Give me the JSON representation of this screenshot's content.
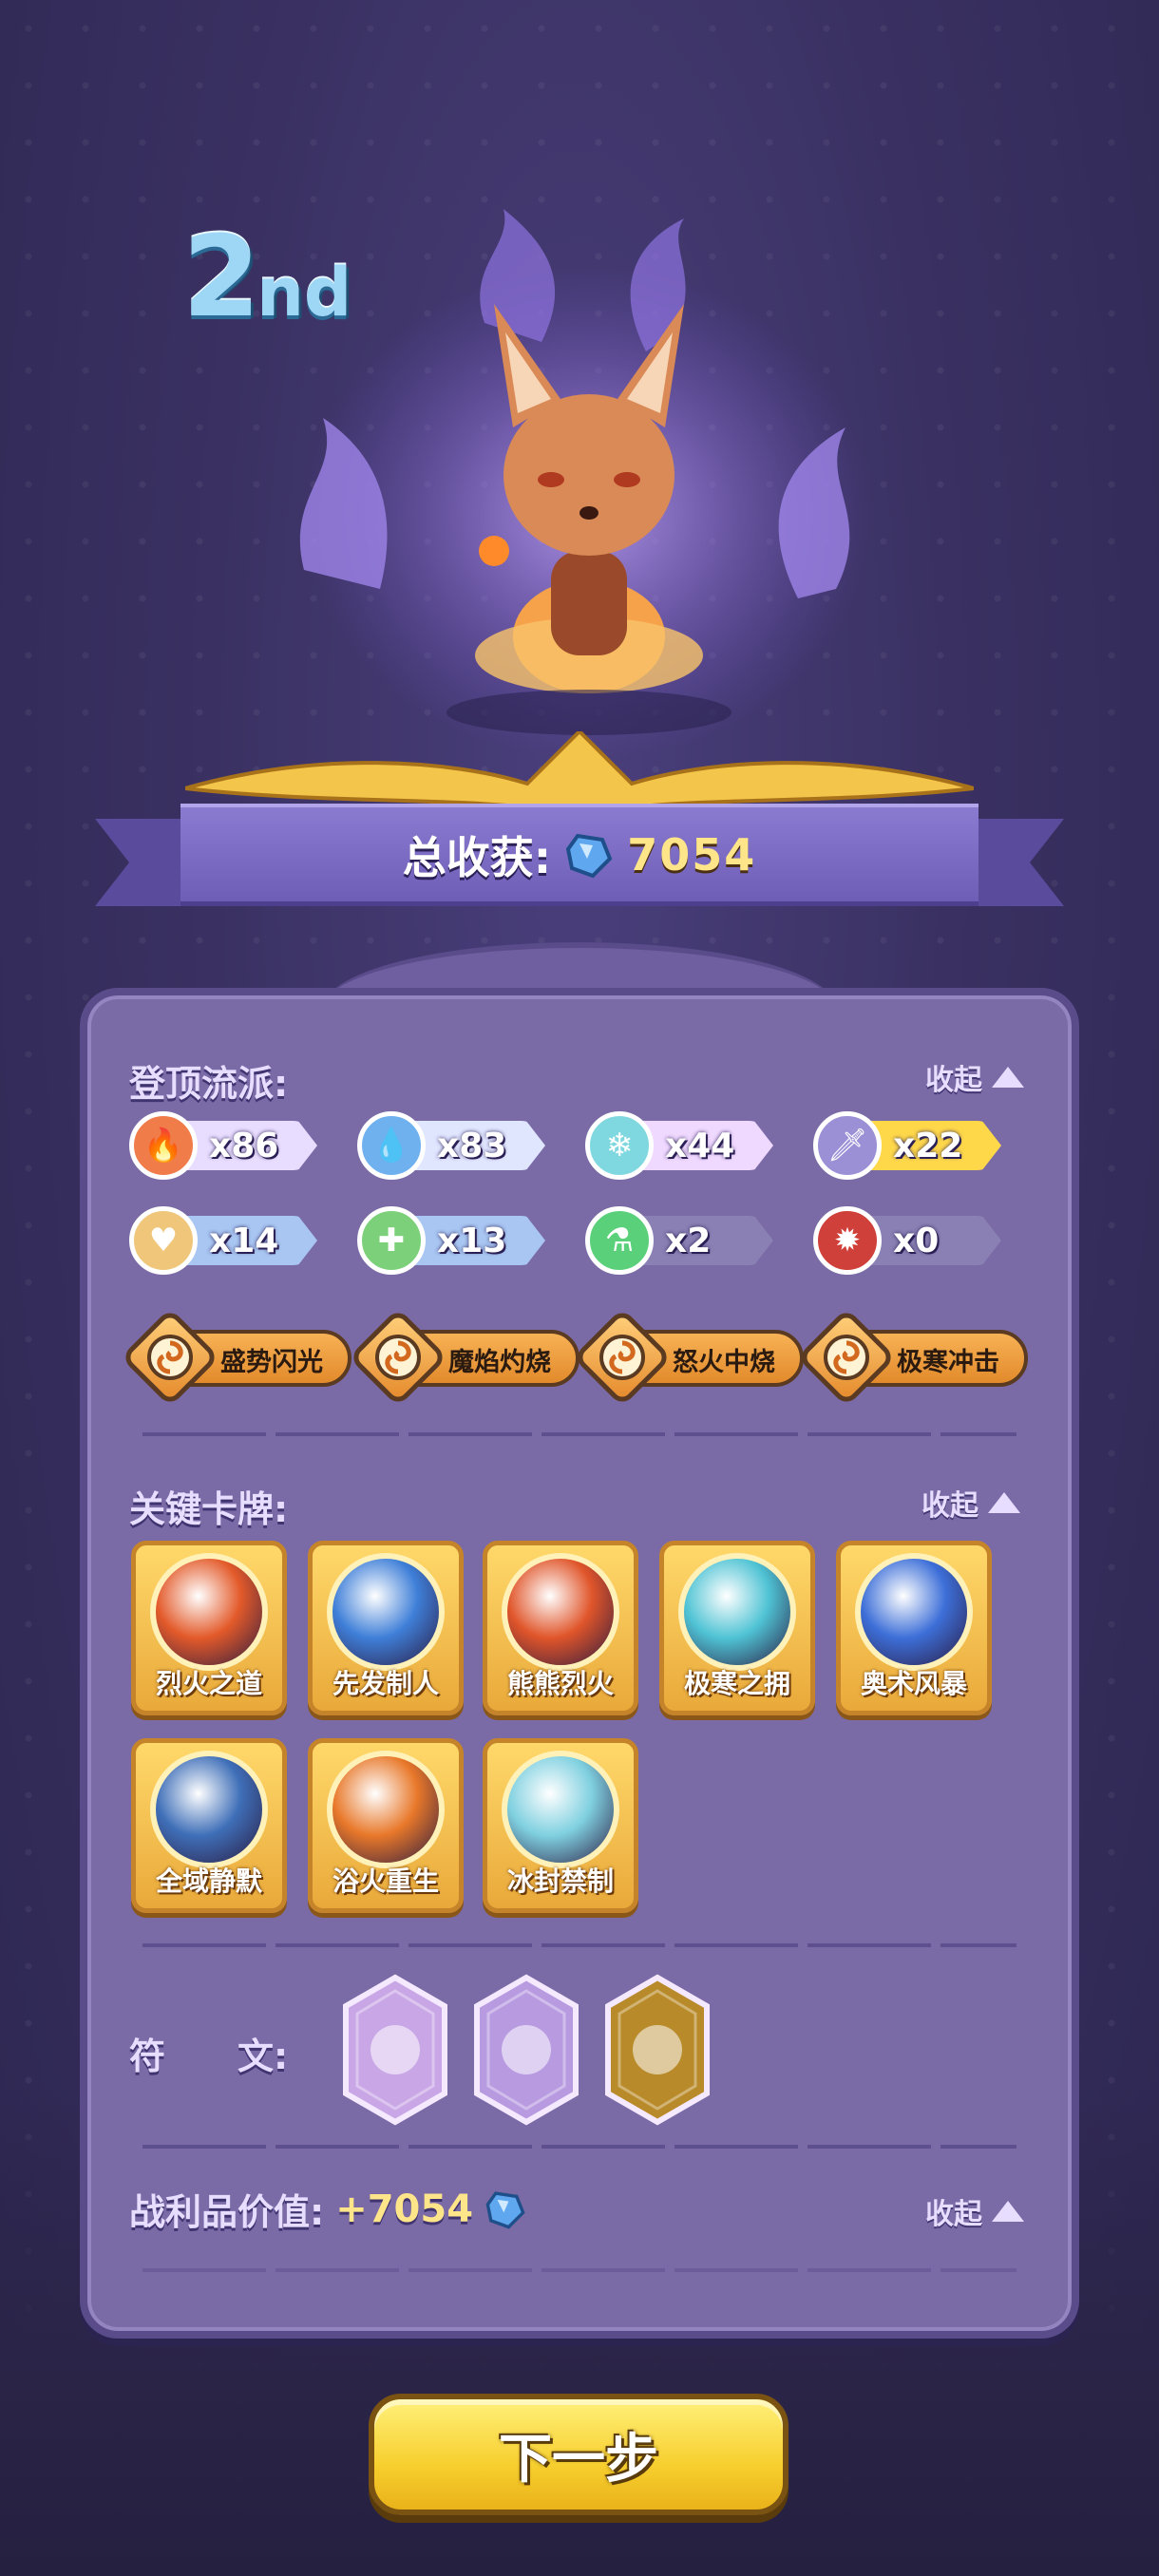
{
  "rank": {
    "number": "2",
    "suffix": "nd"
  },
  "header": {
    "total_label": "总收获:",
    "total_value": "7054",
    "gem_icon": "blue-crystal-icon"
  },
  "route": {
    "title": "登顶流派:",
    "collapse_label": "收起",
    "counters": [
      {
        "icon": "fire-icon",
        "value": "x86",
        "circle": "#f07c4a",
        "pill": "#e9ddff"
      },
      {
        "icon": "water-drop-icon",
        "value": "x83",
        "circle": "#6fb0ef",
        "pill": "#e1e6ff"
      },
      {
        "icon": "snowflake-icon",
        "value": "x44",
        "circle": "#7fd8e0",
        "pill": "#f0d9ff"
      },
      {
        "icon": "sword-icon",
        "value": "x22",
        "circle": "#9b8fd6",
        "pill": "#ffd84a"
      },
      {
        "icon": "heart-icon",
        "value": "x14",
        "circle": "#f0c77a",
        "pill": "#a9c6f2"
      },
      {
        "icon": "plus-icon",
        "value": "x13",
        "circle": "#7cd07a",
        "pill": "#a9c6f2"
      },
      {
        "icon": "potion-icon",
        "value": "x2",
        "circle": "#5bd07a",
        "pill": "#8a80b4"
      },
      {
        "icon": "burst-icon",
        "value": "x0",
        "circle": "#d0403a",
        "pill": "#8a80b4"
      }
    ],
    "skills": [
      "盛势闪光",
      "魔焰灼烧",
      "怒火中烧",
      "极寒冲击"
    ]
  },
  "cards": {
    "title": "关键卡牌:",
    "collapse_label": "收起",
    "items": [
      {
        "label": "烈火之道",
        "icon": "flame-orb-icon",
        "color": "#e35a2a"
      },
      {
        "label": "先发制人",
        "icon": "blue-creature-icon",
        "color": "#3f7fd8"
      },
      {
        "label": "熊熊烈火",
        "icon": "blazing-fire-icon",
        "color": "#e0552a"
      },
      {
        "label": "极寒之拥",
        "icon": "ice-crystal-icon",
        "color": "#4fc3d4"
      },
      {
        "label": "奥术风暴",
        "icon": "arcane-storm-icon",
        "color": "#3d6fd8"
      },
      {
        "label": "全域静默",
        "icon": "silence-mask-icon",
        "color": "#3f6fb8"
      },
      {
        "label": "浴火重生",
        "icon": "phoenix-rebirth-icon",
        "color": "#e8782a"
      },
      {
        "label": "冰封禁制",
        "icon": "frozen-seal-icon",
        "color": "#7fd0e0"
      }
    ]
  },
  "runes": {
    "title": "符　　文:",
    "items": [
      {
        "icon": "caterpillar-rune-icon",
        "color": "#c9a6e6"
      },
      {
        "icon": "swirl-rune-icon",
        "color": "#b89ae0"
      },
      {
        "icon": "golden-heart-rune-icon",
        "color": "#b88a2a"
      }
    ]
  },
  "loot": {
    "title": "战利品价值:",
    "value": "+7054",
    "collapse_label": "收起"
  },
  "next_button": {
    "label": "下一步"
  }
}
